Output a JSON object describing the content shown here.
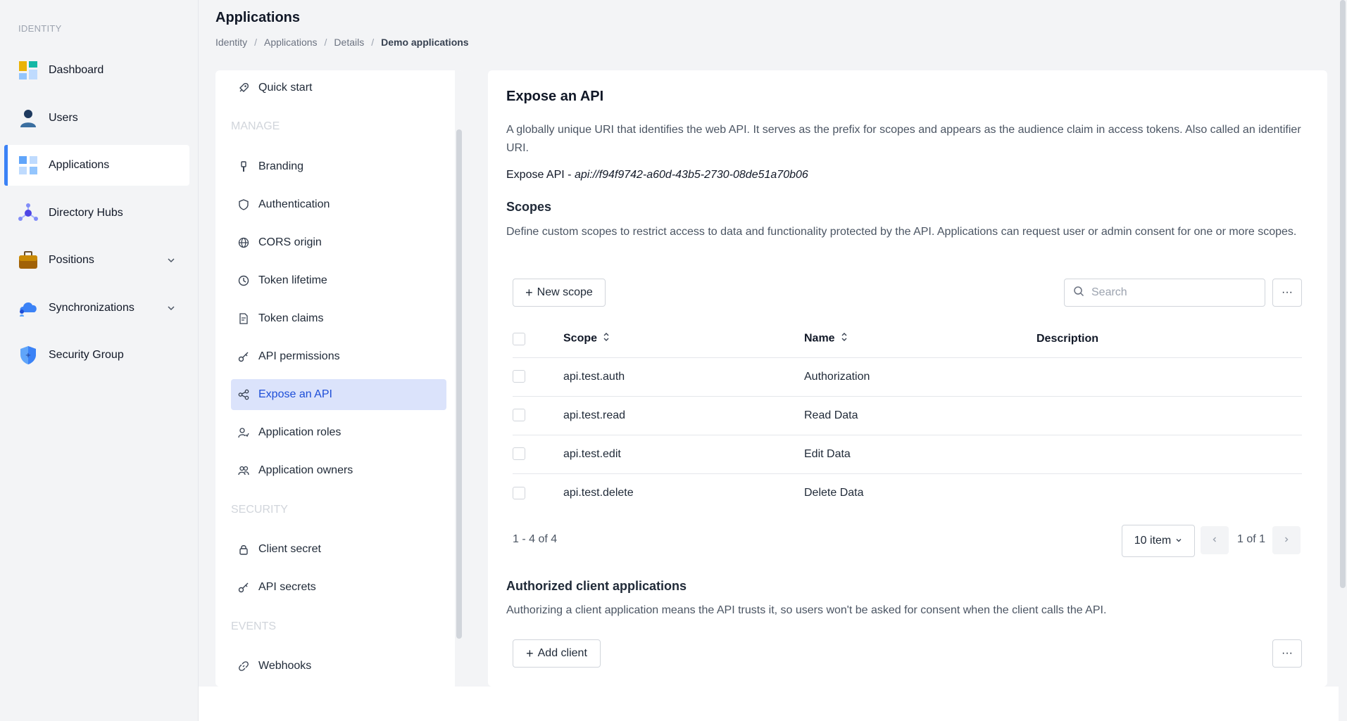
{
  "sidebar": {
    "section_label": "IDENTITY",
    "items": [
      {
        "label": "Dashboard",
        "icon": "dashboard-icon"
      },
      {
        "label": "Users",
        "icon": "user-icon"
      },
      {
        "label": "Applications",
        "icon": "applications-icon",
        "active": true
      },
      {
        "label": "Directory Hubs",
        "icon": "directory-hub-icon"
      },
      {
        "label": "Positions",
        "icon": "briefcase-icon",
        "expandable": true
      },
      {
        "label": "Synchronizations",
        "icon": "cloud-sync-icon",
        "expandable": true
      },
      {
        "label": "Security Group",
        "icon": "shield-icon"
      }
    ]
  },
  "header": {
    "title": "Applications",
    "breadcrumb": [
      "Identity",
      "Applications",
      "Details",
      "Demo applications"
    ]
  },
  "settings_nav": {
    "quick_start": "Quick start",
    "manage_header": "MANAGE",
    "manage": [
      "Branding",
      "Authentication",
      "CORS origin",
      "Token lifetime",
      "Token claims",
      "API permissions",
      "Expose an API",
      "Application roles",
      "Application owners"
    ],
    "security_header": "SECURITY",
    "security": [
      "Client secret",
      "API secrets"
    ],
    "events_header": "EVENTS",
    "events": [
      "Webhooks"
    ]
  },
  "main": {
    "title": "Expose an API",
    "description": "A globally unique URI that identifies the web API. It serves as the prefix for scopes and appears as the audience claim in access tokens. Also called an identifier URI.",
    "expose_label": "Expose API - ",
    "expose_uri": "api://f94f9742-a60d-43b5-2730-08de51a70b06",
    "scopes_title": "Scopes",
    "scopes_description": "Define custom scopes to restrict access to data and functionality protected by the API. Applications can request user or admin consent for one or more scopes.",
    "new_scope_label": "New scope",
    "search_placeholder": "Search",
    "more_label": "···",
    "table": {
      "headers": {
        "scope": "Scope",
        "name": "Name",
        "description": "Description"
      },
      "rows": [
        {
          "scope": "api.test.auth",
          "name": "Authorization",
          "description": ""
        },
        {
          "scope": "api.test.read",
          "name": "Read Data",
          "description": ""
        },
        {
          "scope": "api.test.edit",
          "name": "Edit Data",
          "description": ""
        },
        {
          "scope": "api.test.delete",
          "name": "Delete Data",
          "description": ""
        }
      ]
    },
    "pagination": {
      "count": "1 - 4 of 4",
      "page_size": "10 item",
      "page_info": "1 of 1"
    },
    "authorized_title": "Authorized client applications",
    "authorized_description": "Authorizing a client application means the API trusts it, so users won't be asked for consent when the client calls the API.",
    "add_client_label": "Add client"
  },
  "colors": {
    "accent": "#3b82f6",
    "active_bg": "#dbe3fb",
    "active_text": "#1d4ed8"
  }
}
